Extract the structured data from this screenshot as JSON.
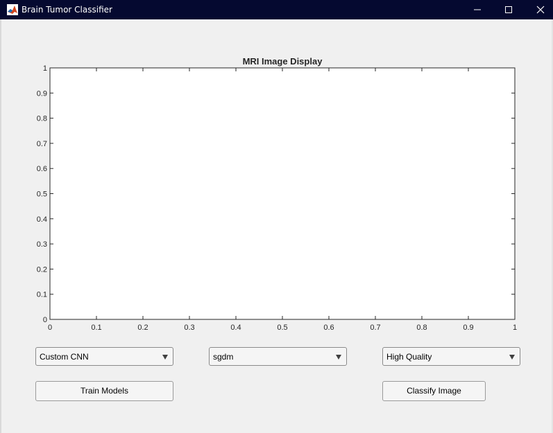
{
  "window": {
    "title": "Brain Tumor Classifier",
    "icon": "matlab-icon",
    "controls": [
      "minimize-icon",
      "maximize-icon",
      "close-icon"
    ]
  },
  "plot": {
    "title": "MRI Image Display",
    "xticks": [
      "0",
      "0.1",
      "0.2",
      "0.3",
      "0.4",
      "0.5",
      "0.6",
      "0.7",
      "0.8",
      "0.9",
      "1"
    ],
    "yticks": [
      "0",
      "0.1",
      "0.2",
      "0.3",
      "0.4",
      "0.5",
      "0.6",
      "0.7",
      "0.8",
      "0.9",
      "1"
    ],
    "xlim": [
      0,
      1
    ],
    "ylim": [
      0,
      1
    ],
    "empty": true
  },
  "controls": {
    "model_dropdown": "Custom CNN",
    "optimizer_dropdown": "sgdm",
    "quality_dropdown": "High Quality",
    "train_button": "Train Models",
    "classify_button": "Classify Image"
  },
  "colors": {
    "titlebar": "#050930",
    "background": "#f0f0f0",
    "axes_background": "#ffffff",
    "axes_color": "#262626"
  }
}
